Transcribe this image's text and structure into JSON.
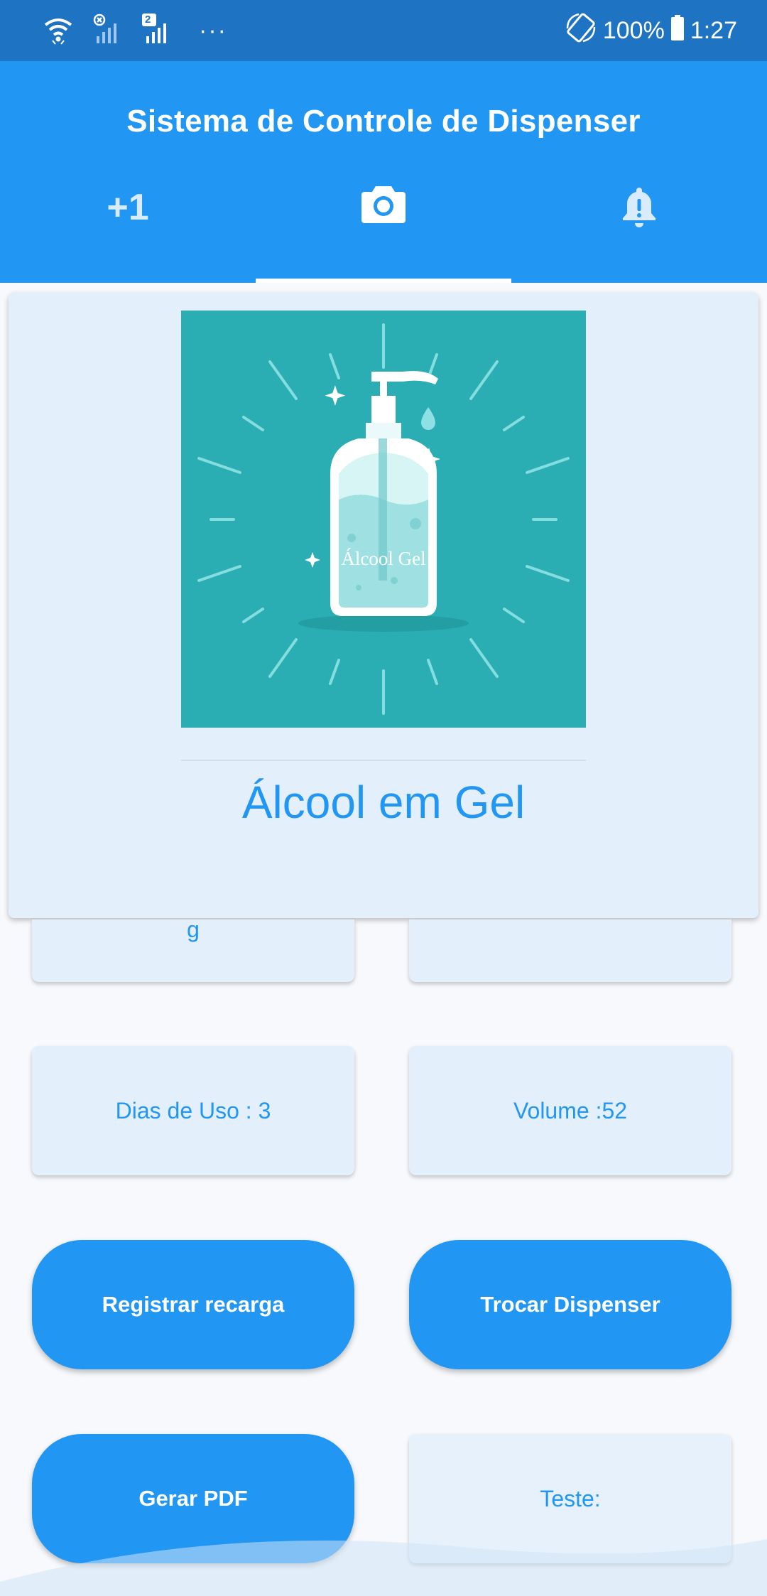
{
  "status_bar": {
    "icons": [
      "wifi-icon",
      "no-signal-sim1-icon",
      "signal-sim2-icon",
      "more-notifications-icon",
      "screen-rotate-icon",
      "battery-icon"
    ],
    "sim2_badge": "2",
    "more": "···",
    "battery": "100%",
    "time": "1:27"
  },
  "app_bar": {
    "title": "Sistema de Controle de Dispenser",
    "tabs": [
      {
        "label": "+1",
        "icon": null,
        "selected": false
      },
      {
        "label": "",
        "icon": "camera-icon",
        "selected": true
      },
      {
        "label": "",
        "icon": "alert-bell-icon",
        "selected": false
      }
    ]
  },
  "product": {
    "image_label": "Álcool Gel",
    "name": "Álcool em Gel",
    "image_bg": "#2aaeb3"
  },
  "info": {
    "partial_left_text": "g",
    "dias_de_uso": "Dias de Uso : 3",
    "volume": "Volume :52",
    "teste": "Teste:"
  },
  "actions": {
    "registrar": "Registrar recarga",
    "trocar": "Trocar Dispenser",
    "pdf": "Gerar PDF"
  },
  "colors": {
    "primary": "#2196f3",
    "status_bar": "#1e74c2",
    "card_bg": "#e3f0fc"
  }
}
